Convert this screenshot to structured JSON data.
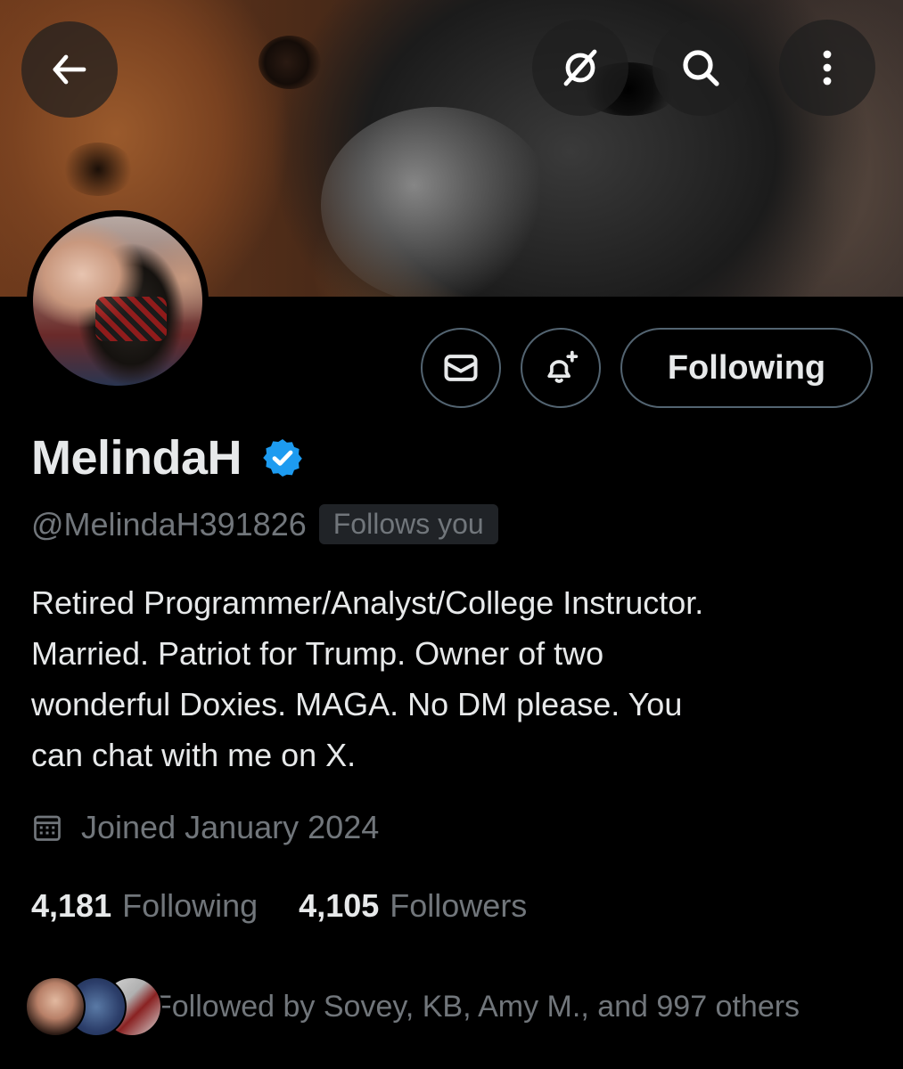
{
  "header": {
    "back_icon": "arrow-left-icon",
    "grok_icon": "slash-circle-icon",
    "search_icon": "search-icon",
    "more_icon": "more-vertical-icon"
  },
  "profile_actions": {
    "message_icon": "mail-icon",
    "notify_icon": "bell-plus-icon",
    "follow_label": "Following"
  },
  "profile": {
    "name": "MelindaH",
    "verified": true,
    "handle": "@MelindaH391826",
    "follows_you": "Follows you",
    "bio": "Retired Programmer/Analyst/College Instructor.\nMarried.  Patriot for Trump.  Owner of two\nwonderful Doxies. MAGA.  No DM please.  You\ncan chat with me on X.",
    "joined": "Joined January 2024"
  },
  "stats": {
    "following_count": "4,181",
    "following_label": "Following",
    "followers_count": "4,105",
    "followers_label": "Followers"
  },
  "followed_by": {
    "text": "Followed by Sovey, KB, Amy M., and 997 others"
  },
  "colors": {
    "background": "#000000",
    "text_primary": "#e7e9ea",
    "text_secondary": "#71767b",
    "border": "#536471",
    "verified_blue": "#1d9bf0"
  }
}
